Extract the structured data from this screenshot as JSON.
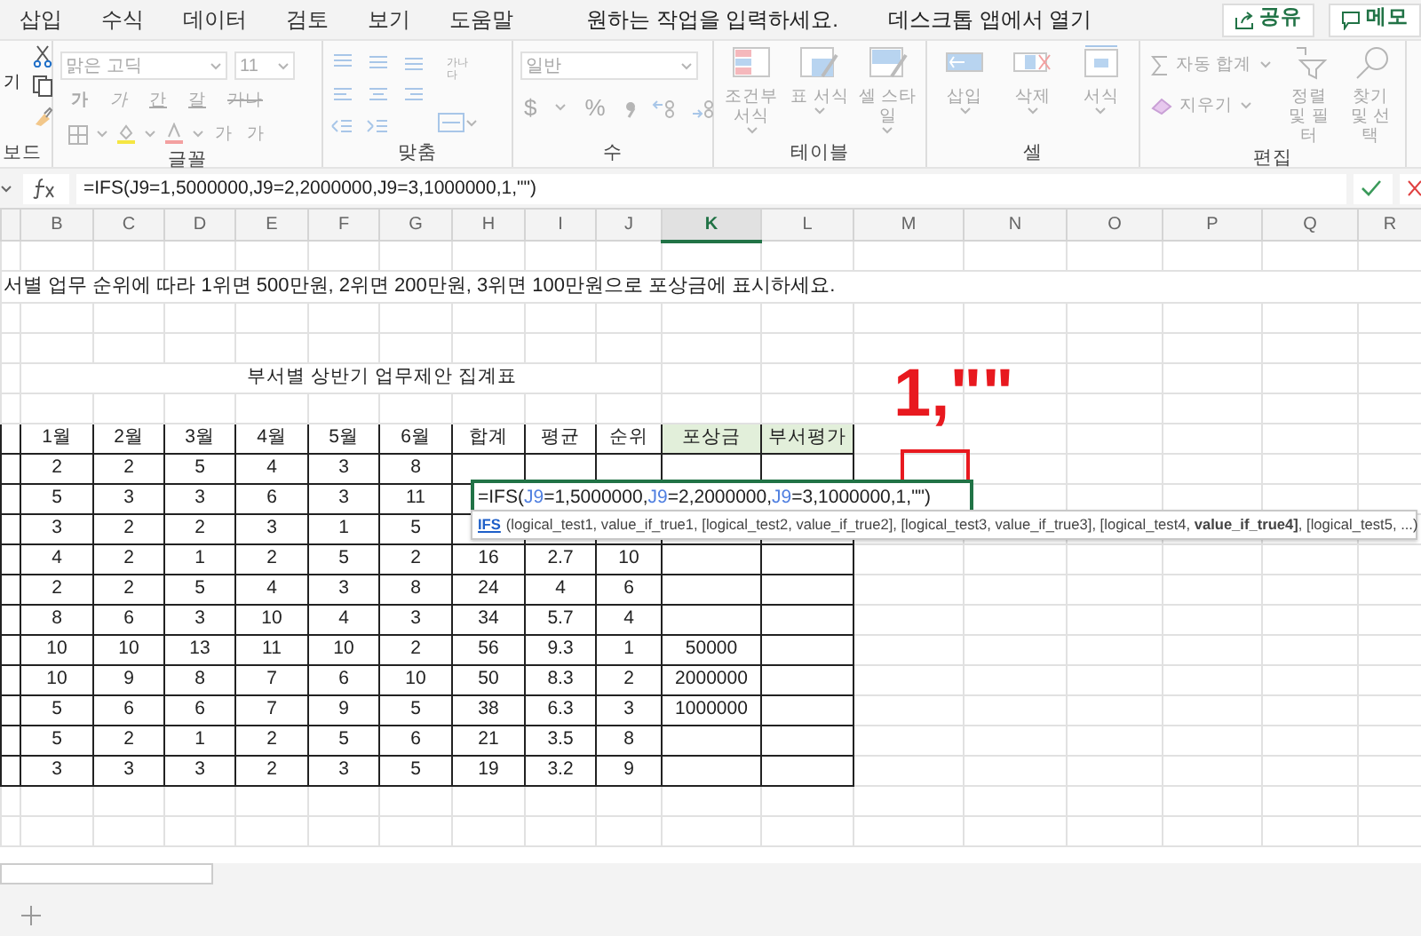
{
  "menu_tabs": [
    {
      "label": "삽입",
      "selected": false
    },
    {
      "label": "수식",
      "selected": false
    },
    {
      "label": "데이터",
      "selected": false
    },
    {
      "label": "검토",
      "selected": false
    },
    {
      "label": "보기",
      "selected": false
    },
    {
      "label": "도움말",
      "selected": false
    }
  ],
  "search_hint": "원하는 작업을 입력하세요.",
  "open_desktop": "데스크톱 앱에서 열기",
  "share_button": "공유",
  "comments_button": "메모",
  "ribbon": {
    "disabled": true,
    "groups": [
      {
        "kind": "clipboard",
        "label": "보드",
        "text": "기"
      },
      {
        "kind": "font",
        "label": "글꼴",
        "font_name": "맑은 고딕",
        "font_size": "11",
        "style_buttons": [
          "가",
          "가",
          "간",
          "갈",
          "가나"
        ],
        "size_buttons": [
          "가",
          "가"
        ]
      },
      {
        "kind": "alignment",
        "label": "맞춤",
        "wrap_text": "가나다"
      },
      {
        "kind": "number",
        "label": "수",
        "format": "일반",
        "symbols": [
          "$",
          "%"
        ]
      },
      {
        "kind": "tables",
        "label": "테이블",
        "buttons": [
          "조건부 서식",
          "표 서식",
          "셀 스타일"
        ]
      },
      {
        "kind": "cells",
        "label": "셀",
        "buttons": [
          "삽입",
          "삭제",
          "서식"
        ]
      },
      {
        "kind": "editing",
        "label": "편집",
        "autosum": "자동 합계",
        "clear": "지우기",
        "sort": "정렬 및 필터",
        "find": "찾기 및 선택"
      }
    ]
  },
  "formula_bar": {
    "formula": "=IFS(J9=1,5000000,J9=2,2000000,J9=3,1000000,1,\"\")"
  },
  "columns": [
    {
      "label": "B",
      "selected": false
    },
    {
      "label": "C",
      "selected": false
    },
    {
      "label": "D",
      "selected": false
    },
    {
      "label": "E",
      "selected": false
    },
    {
      "label": "F",
      "selected": false
    },
    {
      "label": "G",
      "selected": false
    },
    {
      "label": "H",
      "selected": false
    },
    {
      "label": "I",
      "selected": false
    },
    {
      "label": "J",
      "selected": false
    },
    {
      "label": "K",
      "selected": true
    },
    {
      "label": "L",
      "selected": false
    },
    {
      "label": "M",
      "selected": false
    },
    {
      "label": "N",
      "selected": false
    },
    {
      "label": "O",
      "selected": false
    },
    {
      "label": "P",
      "selected": false
    },
    {
      "label": "Q",
      "selected": false
    },
    {
      "label": "R",
      "selected": false
    }
  ],
  "instruction": "서별 업무 순위에 따라 1위면 500만원, 2위면 200만원, 3위면 100만원으로 포상금에 표시하세요.",
  "table_title": "부서별 상반기 업무제안 집계표",
  "table": {
    "header": [
      "1월",
      "2월",
      "3월",
      "4월",
      "5월",
      "6월",
      "합계",
      "평균",
      "순위",
      "포상금",
      "부서평가"
    ],
    "rows": [
      [
        "2",
        "2",
        "5",
        "4",
        "3",
        "8"
      ],
      [
        "5",
        "3",
        "3",
        "6",
        "3",
        "11"
      ],
      [
        "3",
        "2",
        "2",
        "3",
        "1",
        "5"
      ],
      [
        "4",
        "2",
        "1",
        "2",
        "5",
        "2",
        "16",
        "2.7",
        "10"
      ],
      [
        "2",
        "2",
        "5",
        "4",
        "3",
        "8",
        "24",
        "4",
        "6"
      ],
      [
        "8",
        "6",
        "3",
        "10",
        "4",
        "3",
        "34",
        "5.7",
        "4"
      ],
      [
        "10",
        "10",
        "13",
        "11",
        "10",
        "2",
        "56",
        "9.3",
        "1",
        "50000"
      ],
      [
        "10",
        "9",
        "8",
        "7",
        "6",
        "10",
        "50",
        "8.3",
        "2",
        "2000000"
      ],
      [
        "5",
        "6",
        "6",
        "7",
        "9",
        "5",
        "38",
        "6.3",
        "3",
        "1000000"
      ],
      [
        "5",
        "2",
        "1",
        "2",
        "5",
        "6",
        "21",
        "3.5",
        "8"
      ],
      [
        "3",
        "3",
        "3",
        "2",
        "3",
        "5",
        "19",
        "3.2",
        "9"
      ]
    ]
  },
  "editing_cell": {
    "segments": [
      {
        "kind": "text",
        "text": "=IFS("
      },
      {
        "kind": "ref",
        "text": "J9"
      },
      {
        "kind": "text",
        "text": "=1,5000000,"
      },
      {
        "kind": "ref",
        "text": "J9"
      },
      {
        "kind": "text",
        "text": "=2,2000000,"
      },
      {
        "kind": "ref",
        "text": "J9"
      },
      {
        "kind": "text",
        "text": "=3,1000000,1,\"\")"
      }
    ]
  },
  "tooltip": {
    "function": "IFS",
    "arguments": "(logical_test1, value_if_true1, [logical_test2, value_if_true2], [logical_test3, value_if_true3], [logical_test4, **value_if_true4]**, [logical_test5, ...)"
  },
  "annotation": {
    "text": "1,\"\""
  }
}
